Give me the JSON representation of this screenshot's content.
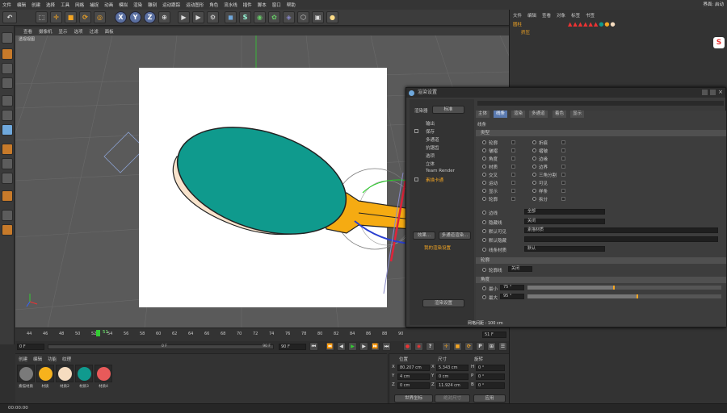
{
  "menubar": {
    "items": [
      "文件",
      "编辑",
      "创建",
      "选择",
      "工具",
      "网格",
      "捕捉",
      "动画",
      "模拟",
      "渲染",
      "雕刻",
      "运动跟踪",
      "运动图形",
      "角色",
      "流水线",
      "插件",
      "脚本",
      "窗口",
      "帮助"
    ],
    "interface": "界面: 启动"
  },
  "toolbar": {
    "axis_x": "X",
    "axis_y": "Y",
    "axis_z": "Z"
  },
  "viewport": {
    "menu": [
      "查看",
      "摄像机",
      "显示",
      "选项",
      "过滤",
      "面板"
    ],
    "title": "透视视图",
    "grid_spacing": "网格间距 : 100 cm"
  },
  "timeline": {
    "ticks": [
      "44",
      "46",
      "48",
      "50",
      "52",
      "54",
      "56",
      "58",
      "60",
      "62",
      "64",
      "66",
      "68",
      "70",
      "72",
      "74",
      "76",
      "78",
      "80",
      "82",
      "84",
      "86",
      "88",
      "90"
    ],
    "current_frame": "51",
    "end_frame": "51 F"
  },
  "transport": {
    "start": "0 F",
    "range_start": "0 F",
    "range_end": "90 F",
    "end": "90 F"
  },
  "materials": {
    "menu": [
      "创建",
      "编辑",
      "功能",
      "纹理"
    ],
    "items": [
      {
        "label": "素描材质",
        "color": "#7a7a7a"
      },
      {
        "label": "材质",
        "color": "#f7b21c"
      },
      {
        "label": "材质2",
        "color": "#f6dcc0"
      },
      {
        "label": "材质3",
        "color": "#109a8e"
      },
      {
        "label": "材质4",
        "color": "#e85a5a"
      }
    ]
  },
  "coords": {
    "headers": [
      "位置",
      "尺寸",
      "旋转"
    ],
    "rows": [
      {
        "axis": "X",
        "pos": "80.207 cm",
        "sizeaxis": "X",
        "size": "5.343 cm",
        "rotaxis": "H",
        "rot": "0 °"
      },
      {
        "axis": "Y",
        "pos": "4 cm",
        "sizeaxis": "Y",
        "size": "0 cm",
        "rotaxis": "P",
        "rot": "0 °"
      },
      {
        "axis": "Z",
        "pos": "0 cm",
        "sizeaxis": "Z",
        "size": "11.924 cm",
        "rotaxis": "B",
        "rot": "0 °"
      }
    ],
    "mode": "世界坐标",
    "scale_mode": "绝对尺寸",
    "apply": "应用"
  },
  "status": {
    "time": "00:00:00"
  },
  "objects": {
    "menu": [
      "文件",
      "编辑",
      "查看",
      "对象",
      "标签",
      "书签"
    ],
    "rows": [
      "圆柱",
      "挤压"
    ]
  },
  "dialog": {
    "title": "渲染设置",
    "renderer_label": "渲染器",
    "renderer": "标准",
    "left_items": [
      "输出",
      "保存",
      "多通道",
      "抗锯齿",
      "选项",
      "立体",
      "Team Render",
      "素描卡通"
    ],
    "effect_btn": "效果...",
    "multi_btn": "多通道渲染...",
    "preset": "我的渲染设置",
    "render_settings_btn": "渲染设置",
    "tabs": [
      "主体",
      "线条",
      "渲染",
      "多通道",
      "着色",
      "显示"
    ],
    "section_lines": "线条",
    "sub_type": "类型",
    "options_left": [
      "轮廓",
      "皱褶",
      "角度",
      "材质",
      "交叉",
      "运动",
      "显示",
      "轮廓"
    ],
    "options_right": [
      "折痕",
      "褶皱",
      "边缘",
      "边界",
      "三角分割",
      "可见",
      "样条",
      "拆分"
    ],
    "cb_label": "边线",
    "edge_select": "全部",
    "hidden_label": "隐藏线",
    "hidden_value": "关闭",
    "default_visible": "默认可见",
    "default_vis_val": "素描材质",
    "default_hidden": "默认隐藏",
    "line_mat": "线条材质",
    "line_mat_val": "默认",
    "section_dist": "轮廓",
    "outline_mode": "轮廓线",
    "outline_val": "关闭",
    "section_angle": "角度",
    "min_label": "最小",
    "min_val": "75 °",
    "max_label": "最大",
    "max_val": "95 °"
  }
}
